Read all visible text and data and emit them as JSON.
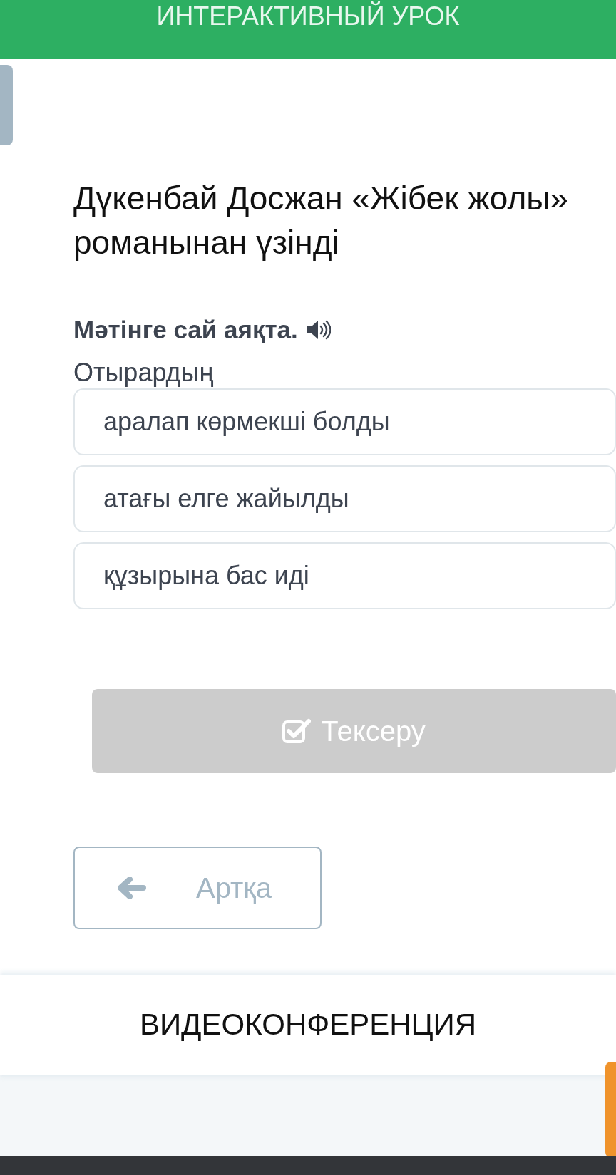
{
  "header": {
    "title": "ИНТЕРАКТИВНЫЙ УРОК"
  },
  "heading_lines": [
    "Дүкенбай Досжан «Жібек жолы»",
    "романынан үзінді"
  ],
  "task": {
    "instruction": "Мәтінге сай аяқта.",
    "prompt": "Отырардың",
    "options": [
      "аралап көрмекші болды",
      "атағы елге жайылды",
      "құзырына бас иді"
    ]
  },
  "check_button": {
    "label": "Тексеру",
    "disabled": true
  },
  "back_button": {
    "label": "Артқа"
  },
  "footer": {
    "title": "ВИДЕОКОНФЕРЕНЦИЯ"
  }
}
